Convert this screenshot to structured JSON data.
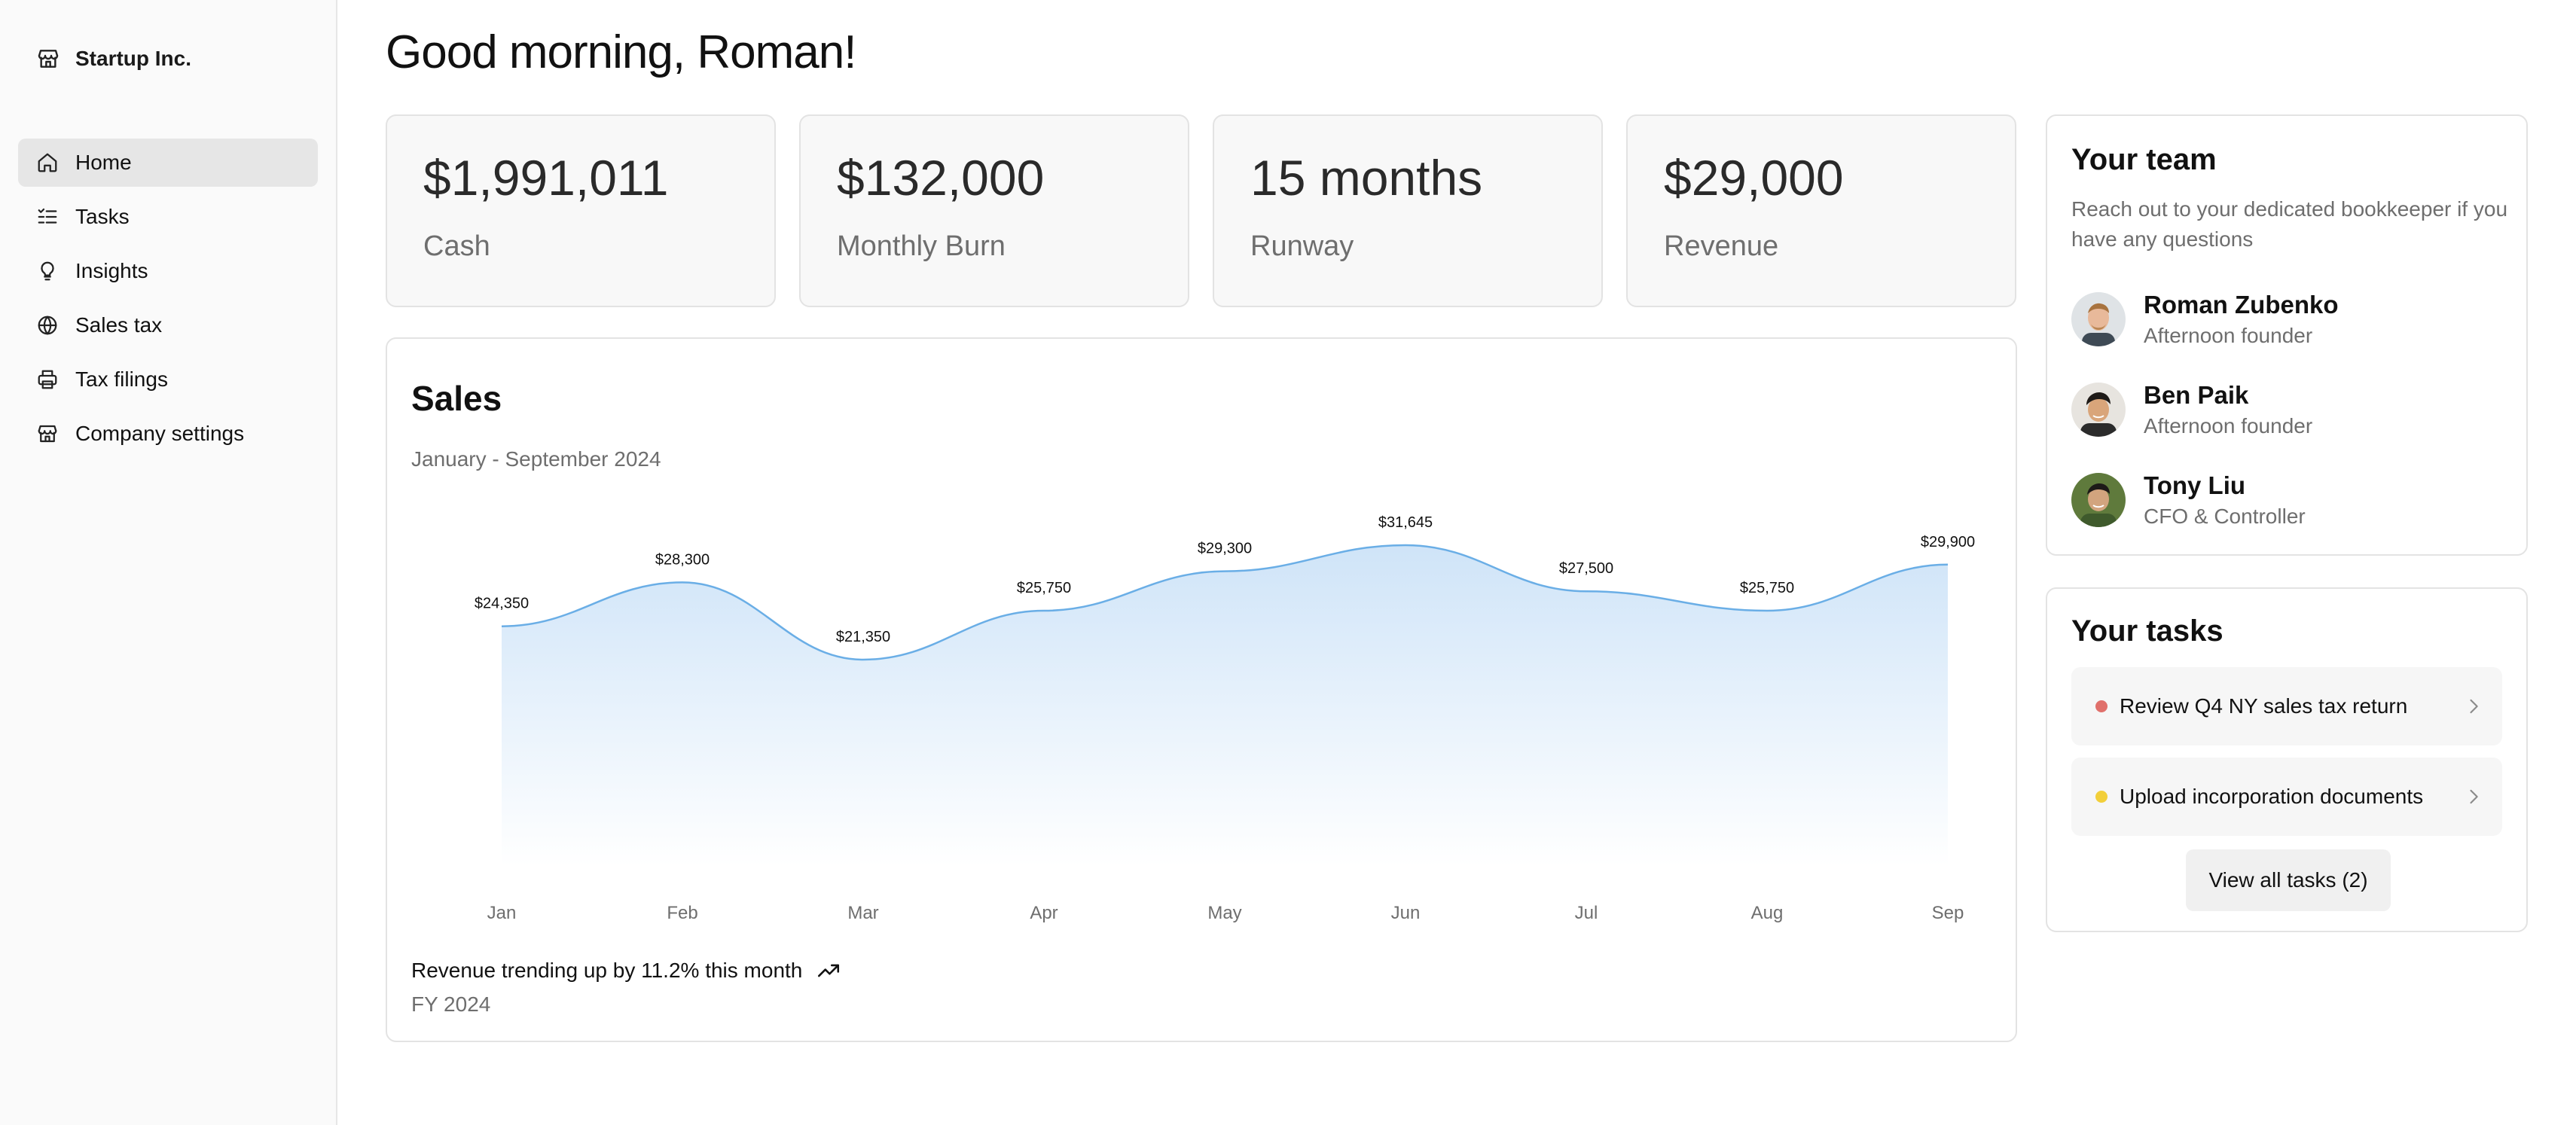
{
  "sidebar": {
    "brand": {
      "name": "Startup Inc.",
      "icon": "store-icon"
    },
    "items": [
      {
        "label": "Home",
        "icon": "home-icon",
        "active": true
      },
      {
        "label": "Tasks",
        "icon": "checklist-icon",
        "active": false
      },
      {
        "label": "Insights",
        "icon": "lightbulb-icon",
        "active": false
      },
      {
        "label": "Sales tax",
        "icon": "globe-icon",
        "active": false
      },
      {
        "label": "Tax filings",
        "icon": "printer-icon",
        "active": false
      },
      {
        "label": "Company settings",
        "icon": "store-icon",
        "active": false
      }
    ]
  },
  "main": {
    "greeting": "Good morning, Roman!",
    "stats": [
      {
        "value": "$1,991,011",
        "label": "Cash"
      },
      {
        "value": "$132,000",
        "label": "Monthly Burn"
      },
      {
        "value": "15 months",
        "label": "Runway"
      },
      {
        "value": "$29,000",
        "label": "Revenue"
      }
    ],
    "sales": {
      "title": "Sales",
      "subtitle": "January - September 2024",
      "trend_text": "Revenue trending up by 11.2% this month",
      "trend_icon": "trending-up-icon",
      "period": "FY 2024"
    }
  },
  "chart_data": {
    "type": "area",
    "categories": [
      "Jan",
      "Feb",
      "Mar",
      "Apr",
      "May",
      "Jun",
      "Jul",
      "Aug",
      "Sep"
    ],
    "values": [
      24350,
      28300,
      21350,
      25750,
      29300,
      31645,
      27500,
      25750,
      29900
    ],
    "labels": [
      "$24,350",
      "$28,300",
      "$21,350",
      "$25,750",
      "$29,300",
      "$31,645",
      "$27,500",
      "$25,750",
      "$29,900"
    ],
    "grid": false,
    "colors": {
      "line": "#6aaee6",
      "fill_top": "#cfe4f8",
      "fill_bottom": "#ffffff"
    }
  },
  "team": {
    "title": "Your team",
    "description": "Reach out to your dedicated bookkeeper if you have any questions",
    "members": [
      {
        "name": "Roman Zubenko",
        "role": "Afternoon founder"
      },
      {
        "name": "Ben Paik",
        "role": "Afternoon founder"
      },
      {
        "name": "Tony Liu",
        "role": "CFO & Controller"
      }
    ]
  },
  "tasks": {
    "title": "Your tasks",
    "items": [
      {
        "label": "Review Q4 NY sales tax return",
        "status_color": "#e0706b"
      },
      {
        "label": "Upload incorporation documents",
        "status_color": "#f2cf3a"
      }
    ],
    "view_all_label": "View all tasks (2)"
  }
}
